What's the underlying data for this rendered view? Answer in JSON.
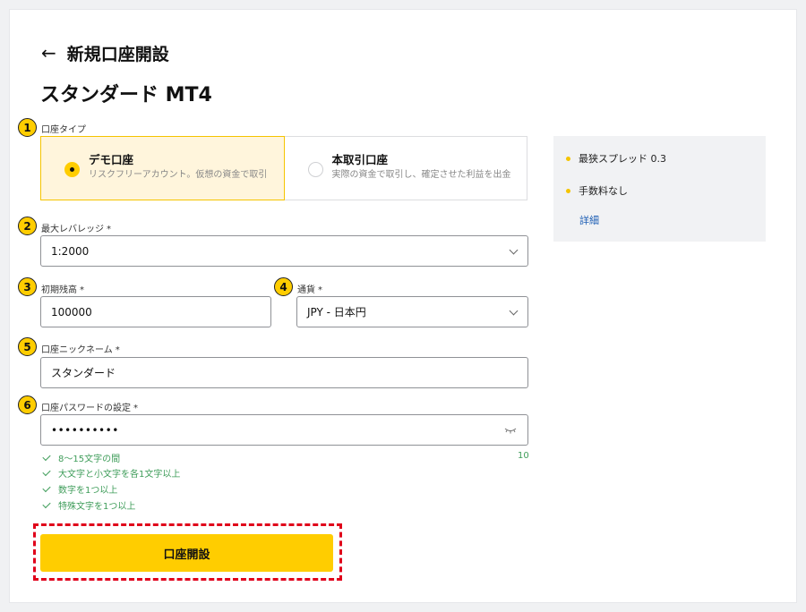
{
  "header": {
    "back_title": "新規口座開設",
    "page_title": "スタンダード MT4"
  },
  "steps": [
    "1",
    "2",
    "3",
    "4",
    "5",
    "6"
  ],
  "account_type": {
    "label": "口座タイプ",
    "options": [
      {
        "title": "デモ口座",
        "desc": "リスクフリーアカウント。仮想の資金で取引",
        "selected": true
      },
      {
        "title": "本取引口座",
        "desc": "実際の資金で取引し、確定させた利益を出金",
        "selected": false
      }
    ]
  },
  "leverage": {
    "label": "最大レバレッジ",
    "required_mark": "*",
    "value": "1:2000"
  },
  "balance": {
    "label": "初期残高",
    "required_mark": "*",
    "value": "100000"
  },
  "currency": {
    "label": "通貨",
    "required_mark": "*",
    "value": "JPY - 日本円"
  },
  "nickname": {
    "label": "口座ニックネーム",
    "required_mark": "*",
    "value": "スタンダード"
  },
  "password": {
    "label": "口座パスワードの設定",
    "required_mark": "*",
    "value": "••••••••••",
    "char_count": "10",
    "rules": [
      "8～15文字の間",
      "大文字と小文字を各1文字以上",
      "数字を1つ以上",
      "特殊文字を1つ以上"
    ]
  },
  "submit_label": "口座開設",
  "info_panel": {
    "items": [
      "最狭スプレッド 0.3",
      "手数料なし"
    ],
    "link": "詳細"
  },
  "colors": {
    "accent": "#ffcd00",
    "success": "#3f9d5a",
    "link": "#1e5fb4",
    "highlight": "#e0001a"
  }
}
